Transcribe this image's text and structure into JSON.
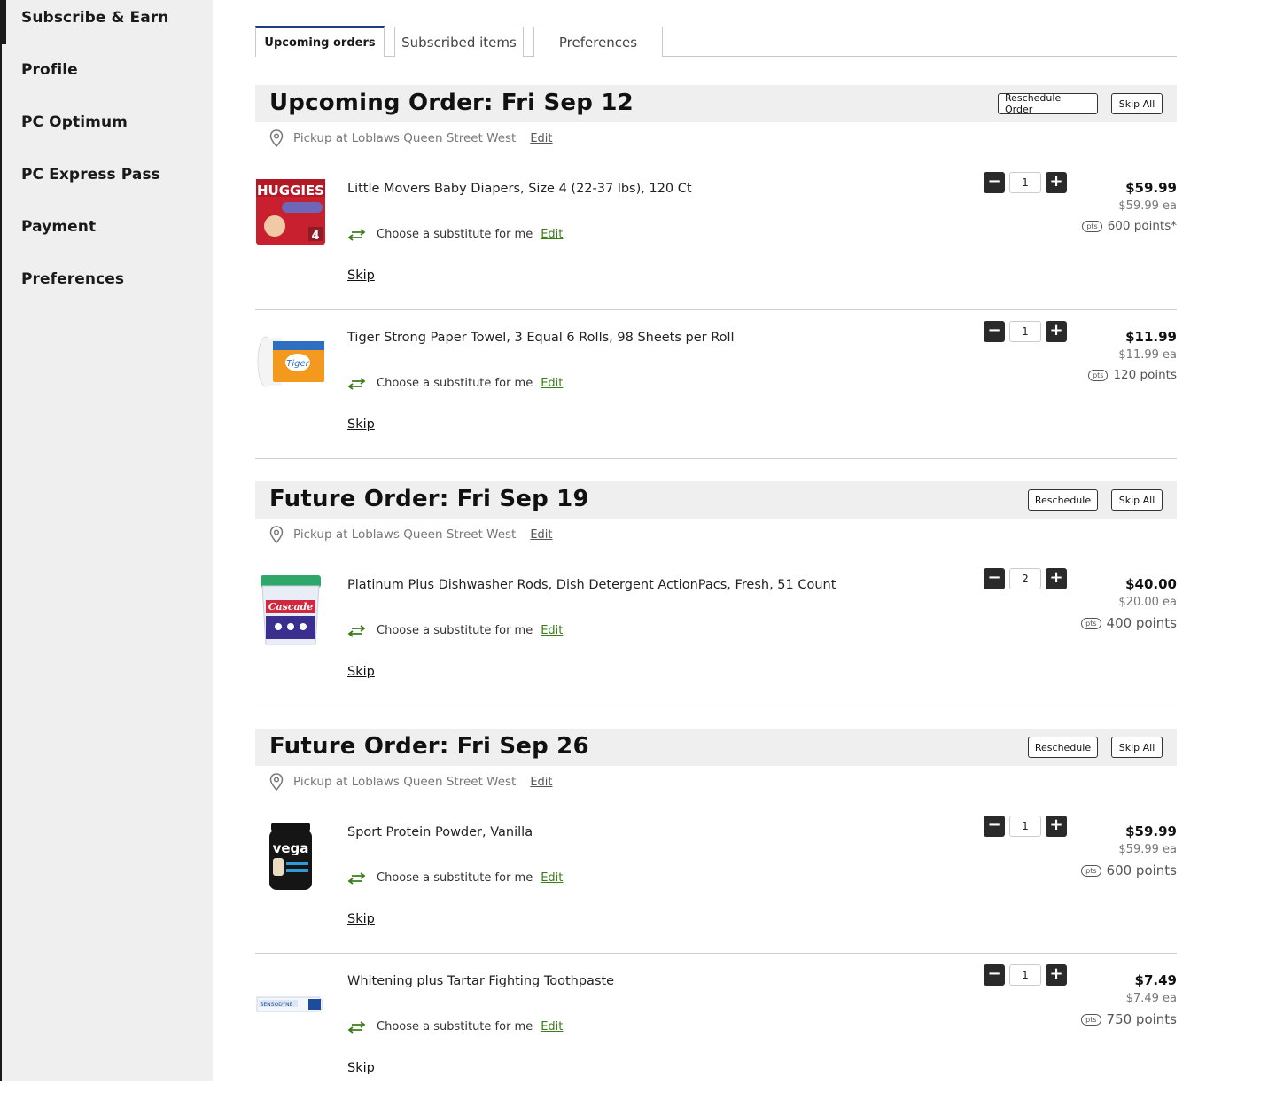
{
  "sidebar": {
    "items": [
      {
        "label": "Subscribe & Earn"
      },
      {
        "label": "Profile"
      },
      {
        "label": "PC Optimum"
      },
      {
        "label": "PC Express Pass"
      },
      {
        "label": "Payment"
      },
      {
        "label": "Preferences"
      }
    ]
  },
  "tabs": [
    {
      "label": "Upcoming orders"
    },
    {
      "label": "Subscribed items"
    },
    {
      "label": "Preferences"
    }
  ],
  "orders": [
    {
      "title": "Upcoming Order: Fri Sep 12",
      "reschedule_label": "Reschedule Order",
      "skip_all_label": "Skip All",
      "pickup": "Pickup at Loblaws Queen Street West",
      "pickup_edit": "Edit",
      "items": [
        {
          "name": "Little Movers Baby Diapers, Size 4 (22-37 lbs), 120 Ct",
          "qty": "1",
          "price": "$59.99",
          "each": "$59.99 ea",
          "points": "600 points*",
          "substitute": "Choose a substitute for me",
          "edit": "Edit",
          "skip": "Skip",
          "image": "diapers-icon"
        },
        {
          "name": "Tiger Strong Paper Towel, 3 Equal 6 Rolls, 98 Sheets per Roll",
          "qty": "1",
          "price": "$11.99",
          "each": "$11.99 ea",
          "points": "120 points",
          "substitute": "Choose a substitute for me",
          "edit": "Edit",
          "skip": "Skip",
          "image": "paper-towel-icon"
        }
      ]
    },
    {
      "title": "Future Order: Fri Sep 19",
      "reschedule_label": "Reschedule",
      "skip_all_label": "Skip All",
      "pickup": "Pickup at Loblaws Queen Street West",
      "pickup_edit": "Edit",
      "items": [
        {
          "name": "Platinum Plus Dishwasher Rods, Dish Detergent ActionPacs, Fresh, 51 Count",
          "qty": "2",
          "price": "$40.00",
          "each": "$20.00 ea",
          "points": "400 points",
          "substitute": "Choose a substitute for me",
          "edit": "Edit",
          "skip": "Skip",
          "image": "detergent-tub-icon"
        }
      ]
    },
    {
      "title": "Future Order: Fri Sep 26",
      "reschedule_label": "Reschedule",
      "skip_all_label": "Skip All",
      "pickup": "Pickup at Loblaws Queen Street West",
      "pickup_edit": "Edit",
      "items": [
        {
          "name": "Sport Protein Powder, Vanilla",
          "qty": "1",
          "price": "$59.99",
          "each": "$59.99 ea",
          "points": "600 points",
          "substitute": "Choose a substitute for me",
          "edit": "Edit",
          "skip": "Skip",
          "image": "protein-tub-icon"
        },
        {
          "name": "Whitening plus Tartar Fighting Toothpaste",
          "qty": "1",
          "price": "$7.49",
          "each": "$7.49 ea",
          "points": "750 points",
          "substitute": "Choose a substitute for me",
          "edit": "Edit",
          "skip": "Skip",
          "image": "toothpaste-icon"
        }
      ]
    }
  ],
  "labels": {
    "pts_badge": "pts",
    "minus": "−",
    "plus": "+"
  },
  "colors": {
    "accent_tab": "#1f3b8a",
    "edit_green": "#3b7d1b",
    "header_bg": "#efefef",
    "dark_button": "#2a2a2a"
  }
}
